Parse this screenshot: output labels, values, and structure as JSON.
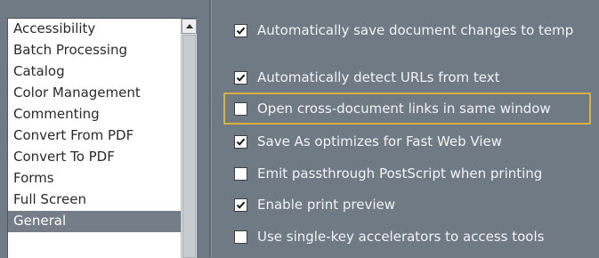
{
  "categories": {
    "items": [
      {
        "label": "Accessibility",
        "selected": false
      },
      {
        "label": "Batch Processing",
        "selected": false
      },
      {
        "label": "Catalog",
        "selected": false
      },
      {
        "label": "Color Management",
        "selected": false
      },
      {
        "label": "Commenting",
        "selected": false
      },
      {
        "label": "Convert From PDF",
        "selected": false
      },
      {
        "label": "Convert To PDF",
        "selected": false
      },
      {
        "label": "Forms",
        "selected": false
      },
      {
        "label": "Full Screen",
        "selected": false
      },
      {
        "label": "General",
        "selected": true
      }
    ]
  },
  "options": [
    {
      "label": "Automatically save document changes to temp",
      "checked": true
    },
    {
      "label": "Automatically detect URLs from text",
      "checked": true
    },
    {
      "label": "Open cross-document links in same window",
      "checked": false,
      "highlighted": true
    },
    {
      "label": "Save As optimizes for Fast Web View",
      "checked": true
    },
    {
      "label": "Emit passthrough PostScript when printing",
      "checked": false
    },
    {
      "label": "Enable print preview",
      "checked": true
    },
    {
      "label": "Use single-key accelerators to access tools",
      "checked": false
    }
  ],
  "colors": {
    "panel_bg": "#707a85",
    "selection_bg": "#757d88",
    "highlight_border": "#d8b240"
  },
  "icons": {
    "check": "checkmark-icon",
    "scroll_up": "up-arrow-icon"
  }
}
